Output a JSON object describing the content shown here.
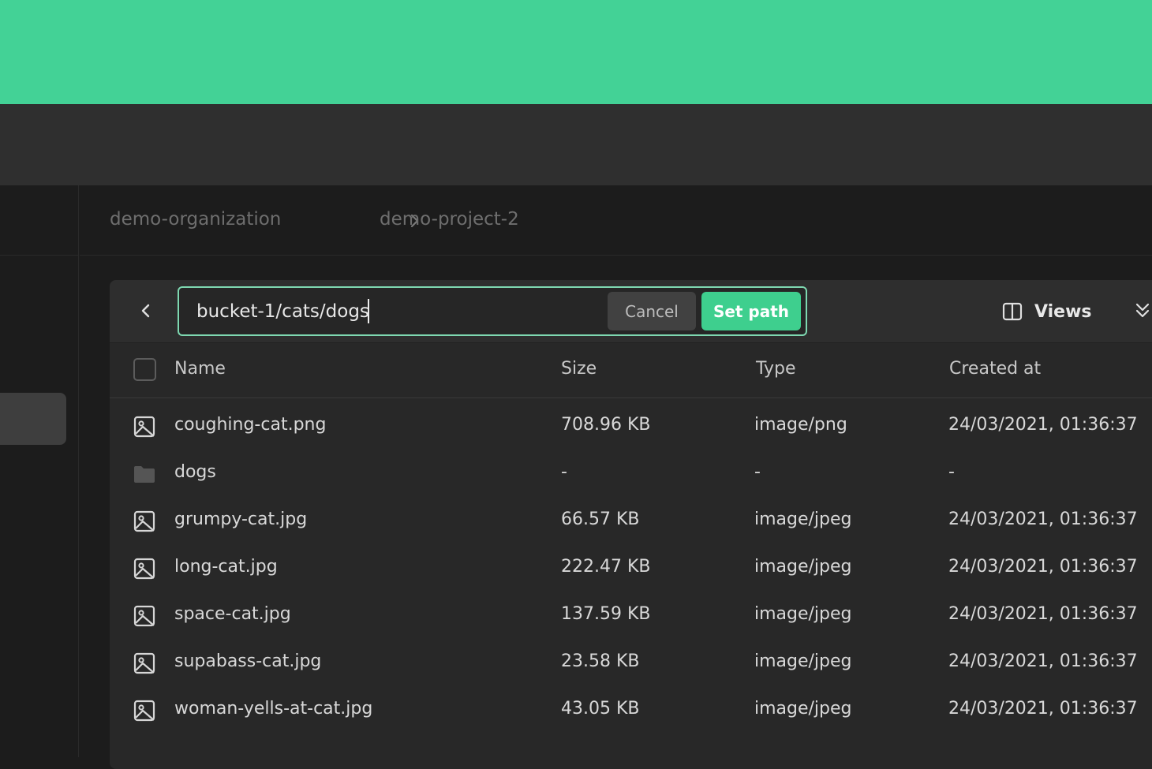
{
  "colors": {
    "banner": "#43d296",
    "accent": "#3ecf8e"
  },
  "breadcrumb": {
    "organization": "demo-organization",
    "project": "demo-project-2"
  },
  "path_editor": {
    "value": "bucket-1/cats/dogs",
    "cancel_label": "Cancel",
    "set_path_label": "Set path"
  },
  "toolbar": {
    "views_label": "Views"
  },
  "columns": {
    "name": "Name",
    "size": "Size",
    "type": "Type",
    "created_at": "Created at"
  },
  "rows": [
    {
      "icon": "image-file-icon",
      "name": "coughing-cat.png",
      "size": "708.96 KB",
      "type": "image/png",
      "created_at": "24/03/2021, 01:36:37"
    },
    {
      "icon": "folder-icon",
      "name": "dogs",
      "size": "-",
      "type": "-",
      "created_at": "-"
    },
    {
      "icon": "image-file-icon",
      "name": "grumpy-cat.jpg",
      "size": "66.57 KB",
      "type": "image/jpeg",
      "created_at": "24/03/2021, 01:36:37"
    },
    {
      "icon": "image-file-icon",
      "name": "long-cat.jpg",
      "size": "222.47 KB",
      "type": "image/jpeg",
      "created_at": "24/03/2021, 01:36:37"
    },
    {
      "icon": "image-file-icon",
      "name": "space-cat.jpg",
      "size": "137.59 KB",
      "type": "image/jpeg",
      "created_at": "24/03/2021, 01:36:37"
    },
    {
      "icon": "image-file-icon",
      "name": "supabass-cat.jpg",
      "size": "23.58 KB",
      "type": "image/jpeg",
      "created_at": "24/03/2021, 01:36:37"
    },
    {
      "icon": "image-file-icon",
      "name": "woman-yells-at-cat.jpg",
      "size": "43.05 KB",
      "type": "image/jpeg",
      "created_at": "24/03/2021, 01:36:37"
    }
  ]
}
